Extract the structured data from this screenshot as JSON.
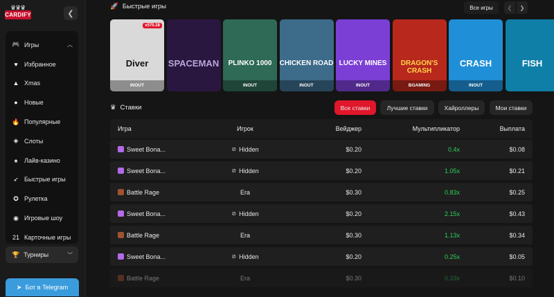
{
  "brand": {
    "logo_text": "CARDIFY",
    "crown": "♛♛♛"
  },
  "sidebar": {
    "items": [
      {
        "icon": "gamepad-icon",
        "glyph": "🎮",
        "label": "Игры",
        "expanded": true
      },
      {
        "icon": "heart-icon",
        "glyph": "♥",
        "label": "Избранное"
      },
      {
        "icon": "santa-hat-icon",
        "glyph": "▲",
        "label": "Xmas"
      },
      {
        "icon": "new-badge-icon",
        "glyph": "●",
        "label": "Новые"
      },
      {
        "icon": "fire-icon",
        "glyph": "🔥",
        "label": "Популярные"
      },
      {
        "icon": "slot-machine-icon",
        "glyph": "◈",
        "label": "Слоты"
      },
      {
        "icon": "live-casino-icon",
        "glyph": "♠",
        "label": "Лайв-казино"
      },
      {
        "icon": "rocket-icon",
        "glyph": "➶",
        "label": "Быстрые игры"
      },
      {
        "icon": "roulette-icon",
        "glyph": "✪",
        "label": "Рулетка"
      },
      {
        "icon": "game-show-icon",
        "glyph": "◉",
        "label": "Игровые шоу"
      },
      {
        "icon": "cards-21-icon",
        "glyph": "21",
        "label": "Карточные игры"
      }
    ],
    "tournaments": {
      "label": "Турниры",
      "glyph": "🏆"
    },
    "telegram": {
      "label": "Бот в Telegram",
      "glyph": "➤"
    }
  },
  "quick_games": {
    "title": "Быстрые игры",
    "all_button": "Все игры",
    "cards": [
      {
        "title": "Diver",
        "provider": "INOUT",
        "badge": "x570.28",
        "bg": "#d9d9d9",
        "title_color": "#111"
      },
      {
        "title": "SPACEMAN",
        "provider": "",
        "bg": "#2a1740",
        "title_color": "#b8a8d8"
      },
      {
        "title": "PLINKO 1000",
        "provider": "INOUT",
        "bg": "#2e6a55",
        "title_color": "#fff"
      },
      {
        "title": "CHICKEN ROAD",
        "provider": "INOUT",
        "bg": "#3d6b8a",
        "title_color": "#fff"
      },
      {
        "title": "LUCKY MINES",
        "provider": "INOUT",
        "bg": "#7b3fd6",
        "title_color": "#fff"
      },
      {
        "title": "DRAGON'S CRASH",
        "provider": "BGAMING",
        "bg": "#b8281c",
        "title_color": "#ffd54a"
      },
      {
        "title": "CRASH",
        "provider": "INOUT",
        "bg": "#1f8fd8",
        "title_color": "#fff"
      },
      {
        "title": "FISH",
        "provider": "",
        "bg": "#0f7fa8",
        "title_color": "#fff"
      }
    ]
  },
  "bets": {
    "title": "Ставки",
    "filters": [
      "Все ставки",
      "Лучшие ставки",
      "Хайроллеры",
      "Мои ставки"
    ],
    "active_filter": "Все ставки",
    "accent": "#e0162b",
    "columns": [
      "Игра",
      "Игрок",
      "Вейджер",
      "Мультипликатор",
      "Выплата"
    ],
    "rows": [
      {
        "game": "Sweet Bona...",
        "game_icon": "sweet-bonanza-icon",
        "player": "Hidden",
        "hidden": true,
        "wager": "$0.20",
        "mult": "0.4x",
        "win": true,
        "payout": "$0.08"
      },
      {
        "game": "Sweet Bona...",
        "game_icon": "sweet-bonanza-icon",
        "player": "Hidden",
        "hidden": true,
        "wager": "$0.20",
        "mult": "1.05x",
        "win": true,
        "payout": "$0.21"
      },
      {
        "game": "Battle Rage",
        "game_icon": "battle-rage-icon",
        "player": "Era",
        "hidden": false,
        "wager": "$0.30",
        "mult": "0.83x",
        "win": true,
        "payout": "$0.25"
      },
      {
        "game": "Sweet Bona...",
        "game_icon": "sweet-bonanza-icon",
        "player": "Hidden",
        "hidden": true,
        "wager": "$0.20",
        "mult": "2.15x",
        "win": true,
        "payout": "$0.43"
      },
      {
        "game": "Battle Rage",
        "game_icon": "battle-rage-icon",
        "player": "Era",
        "hidden": false,
        "wager": "$0.30",
        "mult": "1.13x",
        "win": true,
        "payout": "$0.34"
      },
      {
        "game": "Sweet Bona...",
        "game_icon": "sweet-bonanza-icon",
        "player": "Hidden",
        "hidden": true,
        "wager": "$0.20",
        "mult": "0.25x",
        "win": true,
        "payout": "$0.05"
      },
      {
        "game": "Battle Rage",
        "game_icon": "battle-rage-icon",
        "player": "Era",
        "hidden": false,
        "wager": "$0.30",
        "mult": "0.33x",
        "win": true,
        "payout": "$0.10"
      }
    ]
  },
  "colors": {
    "green": "#2fd05b",
    "telegram": "#3a9cdd"
  }
}
